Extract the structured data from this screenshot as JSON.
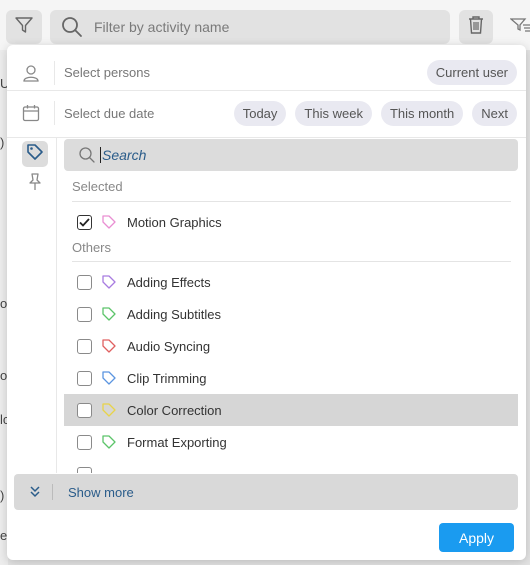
{
  "toolbar": {
    "search_placeholder": "Filter by activity name"
  },
  "filters": {
    "persons_label": "Select persons",
    "current_user_chip": "Current user",
    "due_date_label": "Select due date",
    "date_chips": [
      "Today",
      "This week",
      "This month",
      "Next"
    ]
  },
  "tags": {
    "search_text": "Search",
    "selected_heading": "Selected",
    "others_heading": "Others",
    "selected": [
      {
        "label": "Motion Graphics",
        "color": "#e98fd2",
        "checked": true
      }
    ],
    "others": [
      {
        "label": "Adding Effects",
        "color": "#a87ce0",
        "checked": false
      },
      {
        "label": "Adding Subtitles",
        "color": "#5cc46a",
        "checked": false
      },
      {
        "label": "Audio Syncing",
        "color": "#e06060",
        "checked": false
      },
      {
        "label": "Clip Trimming",
        "color": "#5b95e0",
        "checked": false
      },
      {
        "label": "Color Correction",
        "color": "#e8d44a",
        "checked": false,
        "highlighted": true
      },
      {
        "label": "Format Exporting",
        "color": "#5cc46a",
        "checked": false
      }
    ]
  },
  "footer": {
    "show_more_label": "Show more",
    "apply_label": "Apply"
  },
  "colors": {
    "accent": "#1a9bf0",
    "link": "#2a5c8a"
  },
  "background_fragments": [
    "U",
    ")",
    "or",
    "o",
    "lc",
    ")",
    "es"
  ]
}
